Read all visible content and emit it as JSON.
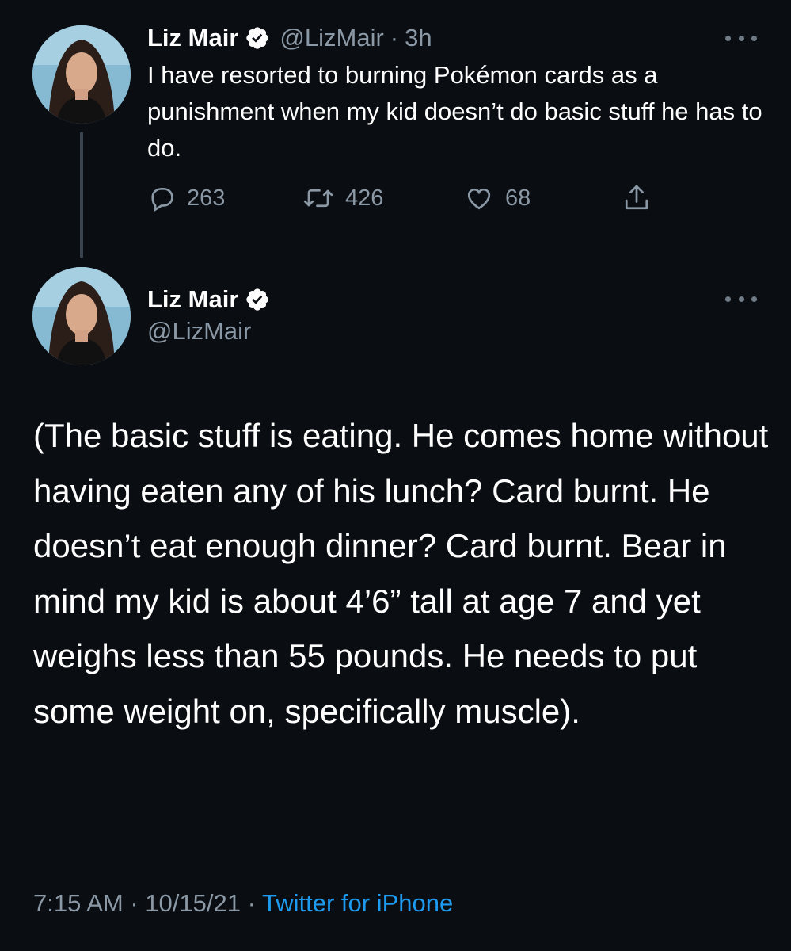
{
  "tweets": [
    {
      "name": "Liz Mair",
      "verified": true,
      "handle": "@LizMair",
      "separator": "·",
      "time": "3h",
      "text": "I have resorted to burning Pokémon cards as a punishment when my kid doesn’t do basic stuff he has to do.",
      "actions": {
        "replies": "263",
        "retweets": "426",
        "likes": "68"
      }
    },
    {
      "name": "Liz Mair",
      "verified": true,
      "handle": "@LizMair",
      "text": "(The basic stuff is eating. He comes home without having eaten any of his lunch? Card burnt. He doesn’t eat enough dinner? Card burnt. Bear in mind my kid is about 4’6” tall at age 7 and yet weighs less than 55 pounds. He needs to put some weight on, specifically muscle).",
      "timestamp": "7:15 AM · 10/15/21",
      "separator": "·",
      "source": "Twitter for iPhone"
    }
  ],
  "icons": {
    "verified": "verified-badge-icon",
    "reply": "reply-icon",
    "retweet": "retweet-icon",
    "like": "heart-icon",
    "share": "share-icon",
    "more": "more-icon"
  },
  "colors": {
    "background": "#0a0d12",
    "text_primary": "#ffffff",
    "text_secondary": "#8b98a5",
    "link": "#1d9bf0",
    "thread_line": "#3a4450"
  }
}
